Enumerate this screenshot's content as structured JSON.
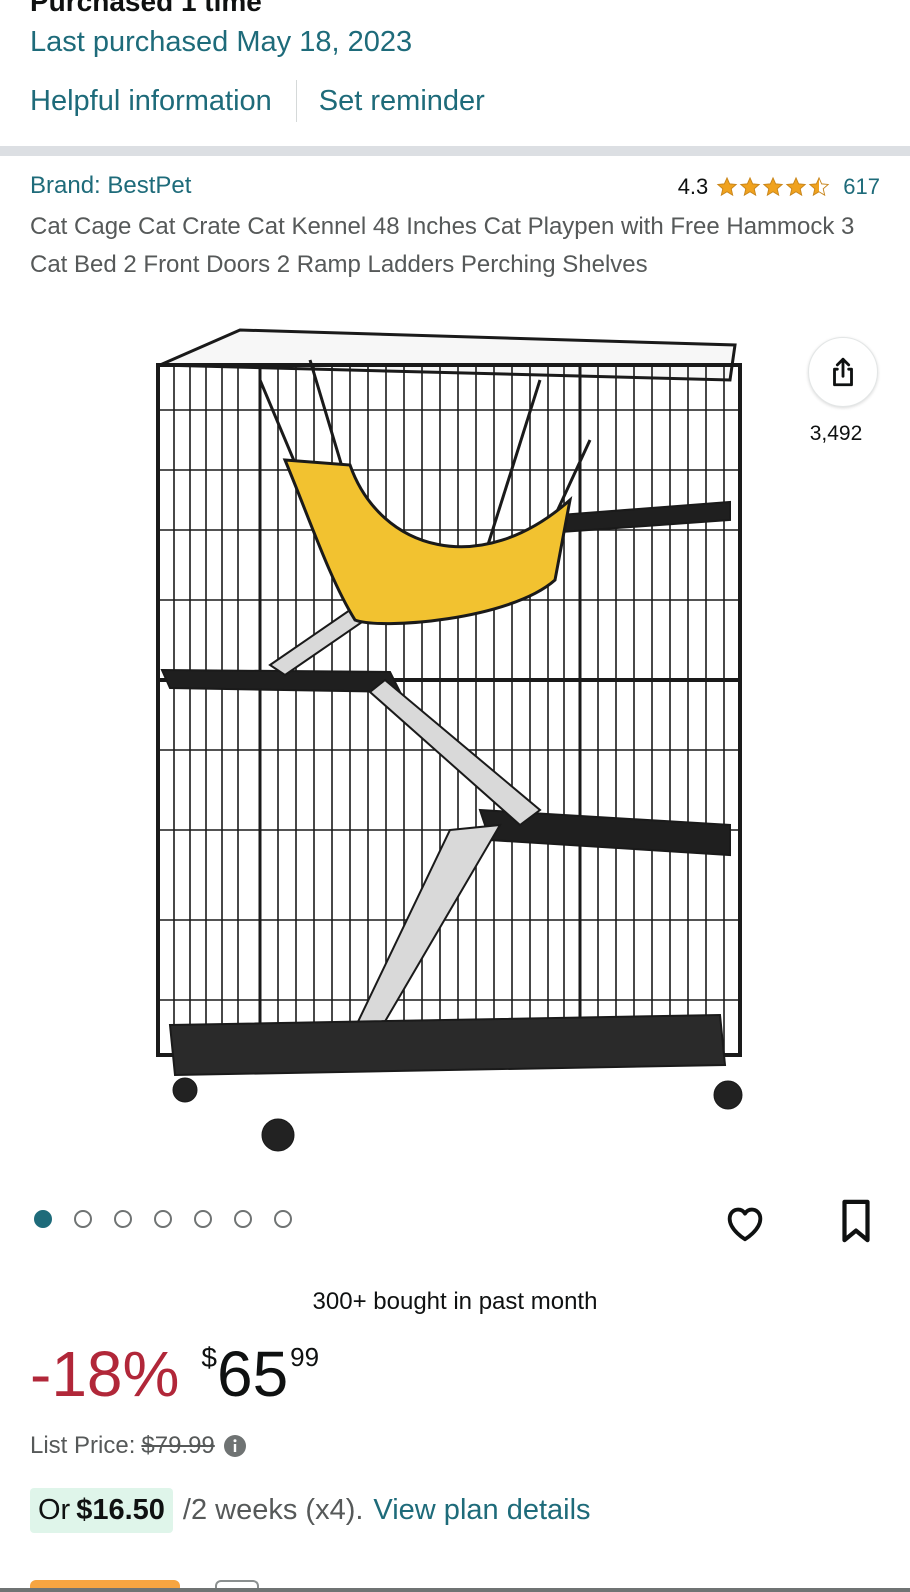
{
  "purchase": {
    "times": "Purchased 1 time",
    "last_purchased": "Last purchased May 18, 2023",
    "helpful_link": "Helpful information",
    "reminder_link": "Set reminder"
  },
  "product": {
    "brand": "Brand: BestPet",
    "rating": "4.3",
    "rating_value": 4.3,
    "rating_max": 5,
    "review_count": "617",
    "title": "Cat Cage Cat Crate Cat Kennel 48 Inches Cat Playpen with Free Hammock 3 Cat Bed 2 Front Doors 2 Ramp Ladders Perching Shelves",
    "share_count": "3,492",
    "image_count": 7,
    "active_image": 1
  },
  "social": {
    "bought": "300+ bought in past month"
  },
  "pricing": {
    "discount": "-18%",
    "currency": "$",
    "whole": "65",
    "fraction": "99",
    "list_price_label": "List Price:",
    "list_price": "$79.99",
    "installment_or": "Or",
    "installment_amount": "$16.50",
    "installment_terms": "/2 weeks (x4).",
    "installment_link": "View plan details"
  },
  "colors": {
    "link": "#1e6b7a",
    "discount": "#b12739",
    "star": "#f0a21e",
    "installment_bg": "#dff5ea",
    "hammock": "#f2c230"
  },
  "icons": [
    "star-icon",
    "share-icon",
    "heart-icon",
    "bookmark-icon",
    "info-icon"
  ]
}
